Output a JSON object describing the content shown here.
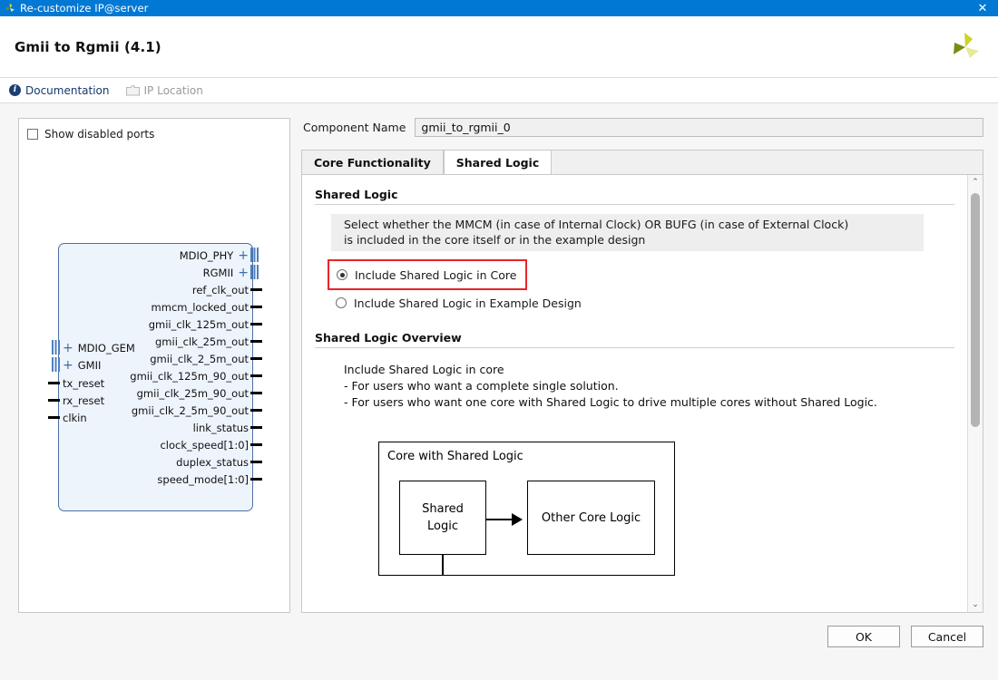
{
  "window": {
    "title": "Re-customize IP@server",
    "close_label": "✕",
    "icon": "xilinx-logo-icon",
    "accent": "#0078d4"
  },
  "header": {
    "title": "Gmii to Rgmii (4.1)",
    "logo": "xilinx-logo-icon"
  },
  "toolbar": {
    "documentation": "Documentation",
    "ip_location": "IP Location"
  },
  "symbol_panel": {
    "show_disabled_ports": "Show disabled ports",
    "show_disabled_checked": false,
    "outputs": [
      {
        "label": "MDIO_PHY",
        "type": "bus"
      },
      {
        "label": "RGMII",
        "type": "bus"
      },
      {
        "label": "ref_clk_out",
        "type": "pin"
      },
      {
        "label": "mmcm_locked_out",
        "type": "pin"
      },
      {
        "label": "gmii_clk_125m_out",
        "type": "pin"
      },
      {
        "label": "gmii_clk_25m_out",
        "type": "pin"
      },
      {
        "label": "gmii_clk_2_5m_out",
        "type": "pin"
      },
      {
        "label": "gmii_clk_125m_90_out",
        "type": "pin"
      },
      {
        "label": "gmii_clk_25m_90_out",
        "type": "pin"
      },
      {
        "label": "gmii_clk_2_5m_90_out",
        "type": "pin"
      },
      {
        "label": "link_status",
        "type": "pin"
      },
      {
        "label": "clock_speed[1:0]",
        "type": "pin"
      },
      {
        "label": "duplex_status",
        "type": "pin"
      },
      {
        "label": "speed_mode[1:0]",
        "type": "pin"
      }
    ],
    "inputs": [
      {
        "label": "MDIO_GEM",
        "type": "bus"
      },
      {
        "label": "GMII",
        "type": "bus"
      },
      {
        "label": "tx_reset",
        "type": "pin"
      },
      {
        "label": "rx_reset",
        "type": "pin"
      },
      {
        "label": "clkin",
        "type": "pin"
      }
    ],
    "expander": "+"
  },
  "config": {
    "component_name_label": "Component Name",
    "component_name_value": "gmii_to_rgmii_0",
    "tabs": [
      {
        "label": "Core Functionality",
        "active": false
      },
      {
        "label": "Shared Logic",
        "active": true
      }
    ],
    "shared_logic": {
      "section_title": "Shared Logic",
      "hint_line1": "Select whether the MMCM (in case of Internal Clock) OR BUFG (in case of External Clock)",
      "hint_line2": "is included in the core itself or in the example design",
      "options": [
        {
          "label": "Include Shared Logic in Core",
          "checked": true,
          "highlighted": true
        },
        {
          "label": "Include Shared Logic in Example Design",
          "checked": false,
          "highlighted": false
        }
      ],
      "highlight_color": "#e8242a"
    },
    "overview": {
      "section_title": "Shared Logic Overview",
      "line1": "Include Shared Logic in core",
      "line2": "- For users who want a complete single solution.",
      "line3": "- For users who want one core with Shared Logic to drive multiple cores without Shared Logic.",
      "diagram": {
        "caption": "Core with Shared Logic",
        "block_a_line1": "Shared",
        "block_a_line2": "Logic",
        "block_b": "Other Core Logic"
      }
    },
    "scrollbar": {
      "up": "⌃",
      "down": "⌄"
    }
  },
  "footer": {
    "ok": "OK",
    "cancel": "Cancel"
  }
}
